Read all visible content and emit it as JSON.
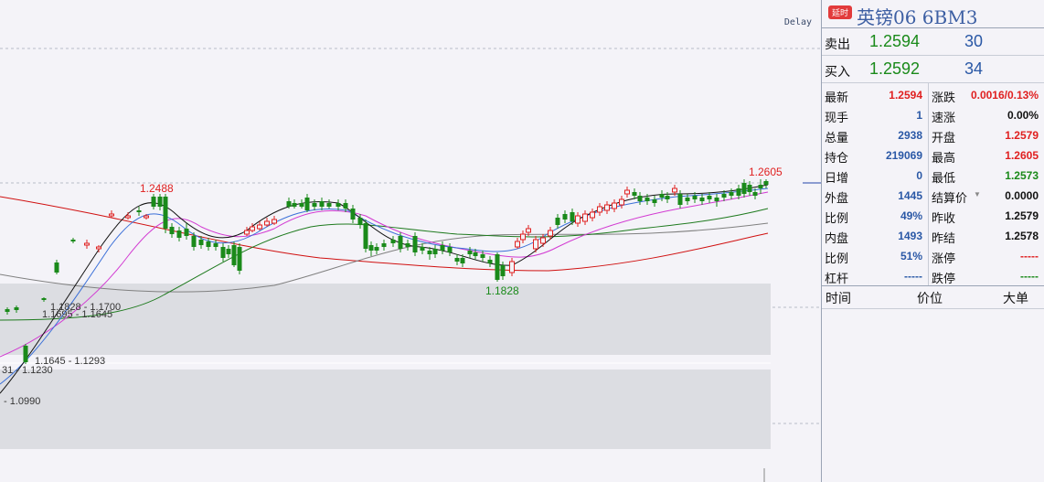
{
  "chart": {
    "delay": "Delay",
    "high_label": "1.2605",
    "local_high_label": "1.2488",
    "low_label": "1.1828",
    "zones": [
      {
        "text": "1.1828 - 1.1700"
      },
      {
        "text": "1.1695 - 1.1645"
      },
      {
        "text": "1.1645 - 1.1293"
      },
      {
        "text": "31 - 1.1230"
      },
      {
        "text": "- 1.0990"
      }
    ],
    "colors": {
      "up": "#e02020",
      "down": "#1a8a1a",
      "ma_black": "#111111",
      "ma_blue": "#3a6fd8",
      "ma_magenta": "#d23ad2",
      "ma_green": "#1e7a1e",
      "ma_gray": "#808080",
      "ma_red": "#d01010"
    }
  },
  "chart_data": {
    "type": "candlestick",
    "series_name": "6BM3",
    "high": 1.2605,
    "low": 1.1828,
    "local_high": 1.2488,
    "zones": [
      "1.1828 - 1.1700",
      "1.1695 - 1.1645",
      "1.1645 - 1.1293",
      "31 - 1.1230",
      "- 1.0990"
    ]
  },
  "panel": {
    "tag": "延时",
    "instrument": "英镑06  6BM3",
    "ask_label": "卖出",
    "ask_price": "1.2594",
    "ask_vol": "30",
    "bid_label": "买入",
    "bid_price": "1.2592",
    "bid_vol": "34",
    "stats_left": [
      {
        "k": "最新",
        "v": "1.2594",
        "c": "up"
      },
      {
        "k": "现手",
        "v": "1",
        "c": "bl"
      },
      {
        "k": "总量",
        "v": "2938",
        "c": "bl"
      },
      {
        "k": "持仓",
        "v": "219069",
        "c": "bl"
      },
      {
        "k": "日增",
        "v": "0",
        "c": "bl"
      },
      {
        "k": "外盘",
        "v": "1445",
        "c": "bl"
      },
      {
        "k": "比例",
        "v": "49%",
        "c": "bl"
      },
      {
        "k": "内盘",
        "v": "1493",
        "c": "bl"
      },
      {
        "k": "比例",
        "v": "51%",
        "c": "bl"
      },
      {
        "k": "杠杆",
        "v": "-----",
        "c": "bl"
      }
    ],
    "stats_right": [
      {
        "k": "涨跌",
        "v": "0.0016/0.13%",
        "c": "up"
      },
      {
        "k": "速涨",
        "v": "0.00%",
        "c": "blk"
      },
      {
        "k": "开盘",
        "v": "1.2579",
        "c": "up"
      },
      {
        "k": "最高",
        "v": "1.2605",
        "c": "up"
      },
      {
        "k": "最低",
        "v": "1.2573",
        "c": "dn"
      },
      {
        "k": "结算价",
        "v": "0.0000",
        "c": "blk"
      },
      {
        "k": "昨收",
        "v": "1.2579",
        "c": "blk"
      },
      {
        "k": "昨结",
        "v": "1.2578",
        "c": "blk"
      },
      {
        "k": "涨停",
        "v": "-----",
        "c": "up"
      },
      {
        "k": "跌停",
        "v": "-----",
        "c": "dn"
      }
    ],
    "tick_headers": {
      "time": "时间",
      "price": "价位",
      "size": "大单"
    }
  }
}
